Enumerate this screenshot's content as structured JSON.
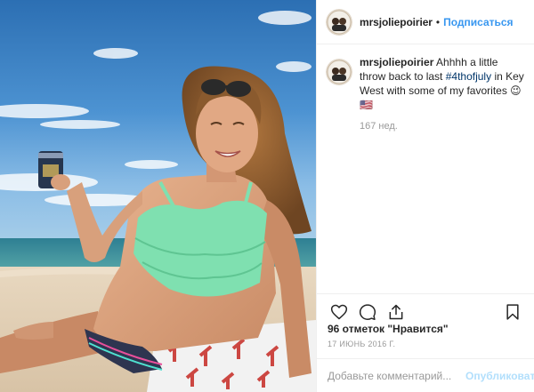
{
  "post": {
    "username": "mrsjoliepoirier",
    "header_separator": "•",
    "follow_label": "Подписаться",
    "caption": {
      "username": "mrsjoliepoirier",
      "text_before": "Ahhhh a little throw back to last",
      "hashtag": "#4thofjuly",
      "text_after": "in Key West with some of my favorites 😉🇺🇸"
    },
    "caption_time": "167 нед.",
    "likes_text": "96 отметок \"Нравится\"",
    "date": "17 ИЮНЬ 2016 Г.",
    "comment_placeholder": "Добавьте комментарий...",
    "publish_label": "Опубликовать"
  },
  "icons": {
    "like": "heart-icon",
    "comment": "comment-icon",
    "share": "share-icon",
    "save": "bookmark-icon"
  },
  "colors": {
    "link_blue": "#3897f0",
    "hashtag": "#003569",
    "muted": "#999999",
    "publish_disabled": "#b2dffc",
    "border": "#efefef"
  }
}
